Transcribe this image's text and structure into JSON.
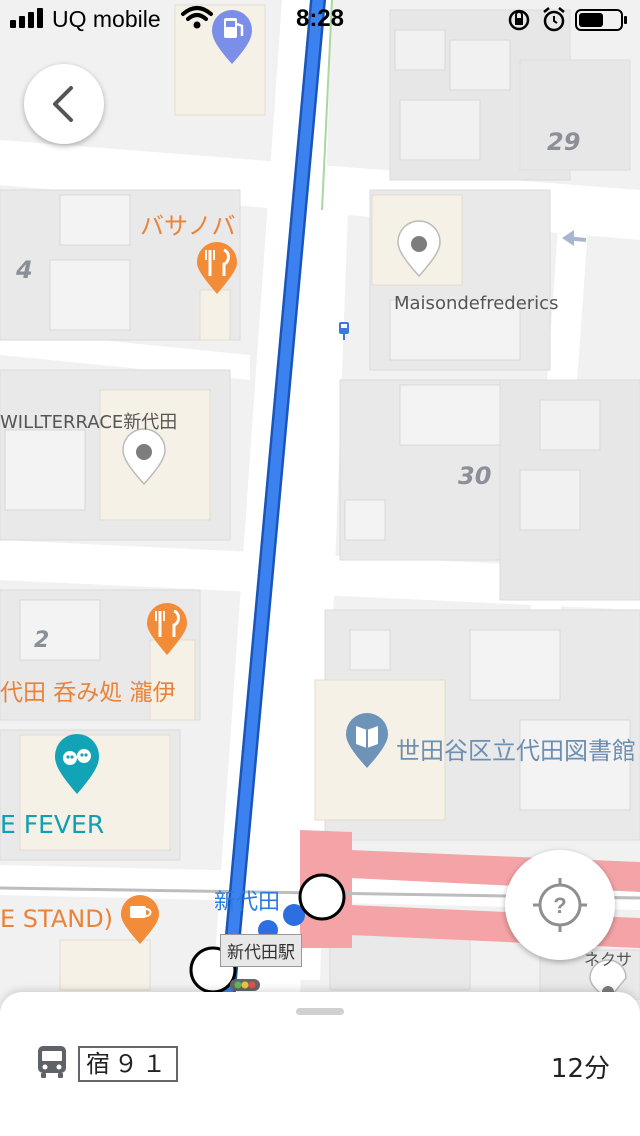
{
  "status_bar": {
    "carrier": "UQ mobile",
    "time": "8:28"
  },
  "map": {
    "poi": {
      "basanoba": "バサノバ",
      "maison": "Maisondefrederics",
      "willterrace": "WILLTERRACE新代田",
      "nomidokoro": "代田 呑み処 瀧伊",
      "fever": "E FEVER",
      "library": "世田谷区立代田図書館",
      "stand": "E STAND)",
      "station_blue": "新代田",
      "station_box": "新代田駅",
      "nekusa": "ネクサ"
    },
    "block_numbers": {
      "b29": "29",
      "b4": "4",
      "b30": "30",
      "b2": "2"
    }
  },
  "bottom_sheet": {
    "route_label": "宿９１",
    "duration": "12分"
  },
  "colors": {
    "route_line": "#1a73e8",
    "food_poi": "#f28c38",
    "teal_poi": "#12a4b6",
    "rail": "#f4a3a6"
  }
}
